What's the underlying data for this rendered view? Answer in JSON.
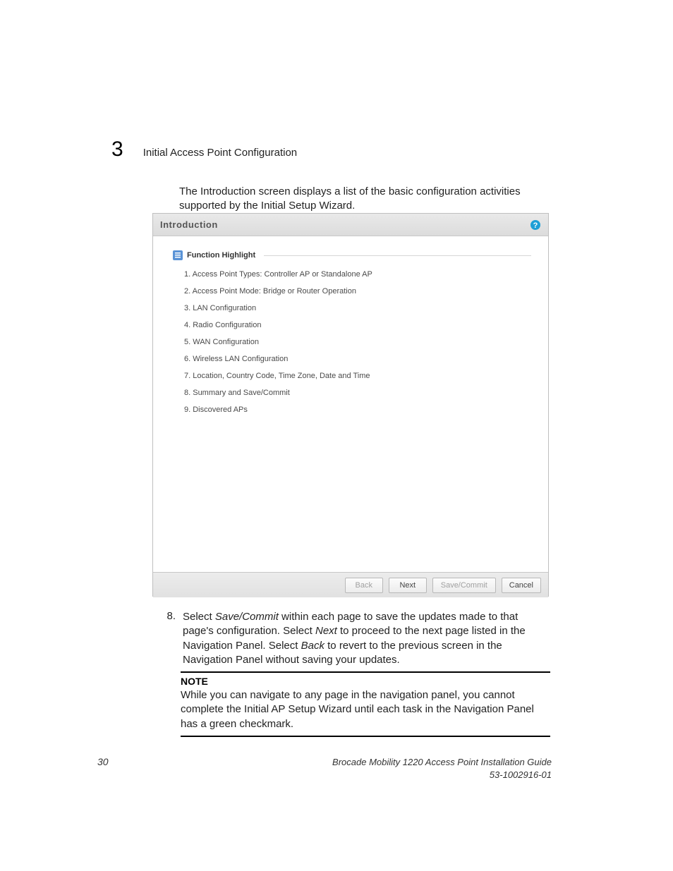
{
  "chapter": {
    "number": "3",
    "title": "Initial Access Point Configuration"
  },
  "intro_paragraph": "The Introduction screen displays a list of the basic configuration activities supported by the Initial Setup Wizard.",
  "dialog": {
    "title": "Introduction",
    "fieldset_label": "Function Highlight",
    "items": [
      "1. Access Point Types: Controller AP or Standalone AP",
      "2. Access Point Mode: Bridge or Router Operation",
      "3. LAN Configuration",
      "4. Radio Configuration",
      "5. WAN Configuration",
      "6. Wireless LAN Configuration",
      "7. Location, Country Code, Time Zone, Date and Time",
      "8. Summary and Save/Commit",
      "9. Discovered APs"
    ],
    "buttons": {
      "back": "Back",
      "next": "Next",
      "save": "Save/Commit",
      "cancel": "Cancel"
    }
  },
  "step8": {
    "number": "8.",
    "prefix": "Select ",
    "em1": "Save/Commit",
    "mid1": " within each page to save the updates made to that page's configuration. Select ",
    "em2": "Next",
    "mid2": " to proceed to the next page listed in the Navigation Panel. Select ",
    "em3": "Back",
    "suffix": " to revert to the previous screen in the Navigation Panel without saving your updates."
  },
  "note": {
    "heading": "NOTE",
    "text": "While you can navigate to any page in the navigation panel, you cannot complete the Initial AP Setup Wizard until each task in the Navigation Panel has a green checkmark."
  },
  "footer": {
    "page_number": "30",
    "doc_title": "Brocade Mobility 1220 Access Point Installation Guide",
    "doc_number": "53-1002916-01"
  }
}
